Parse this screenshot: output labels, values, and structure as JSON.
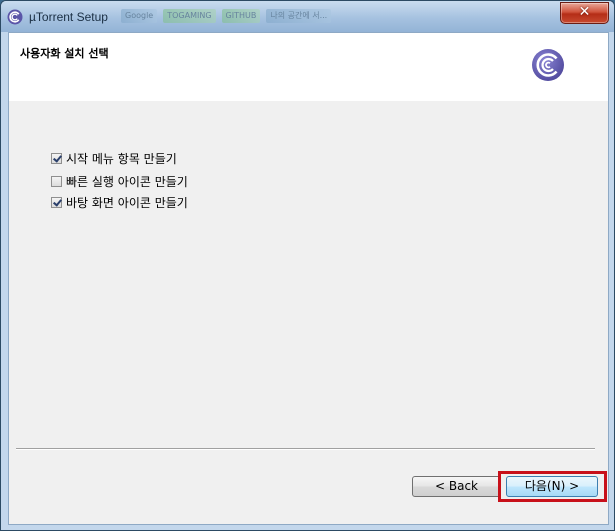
{
  "window": {
    "title": "µTorrent Setup",
    "close_glyph": "✕",
    "background_tabs": [
      "Google",
      "TOGAMING",
      "GITHUB",
      "나의 공간에 서..."
    ]
  },
  "header": {
    "title": "사용자화 설치 선택"
  },
  "options": [
    {
      "label": "시작 메뉴 항목 만들기",
      "checked": true
    },
    {
      "label": "빠른 실행 아이콘 만들기",
      "checked": false
    },
    {
      "label": "바탕 화면 아이콘 만들기",
      "checked": true
    }
  ],
  "buttons": {
    "back_label": "< Back",
    "next_label": "다음(N) >"
  },
  "colors": {
    "brand_logo": "#6a63b6",
    "highlight_box": "#c8101a"
  },
  "icons": {
    "app": "utorrent-icon",
    "brand": "utorrent-logo-icon",
    "close": "close-icon"
  }
}
